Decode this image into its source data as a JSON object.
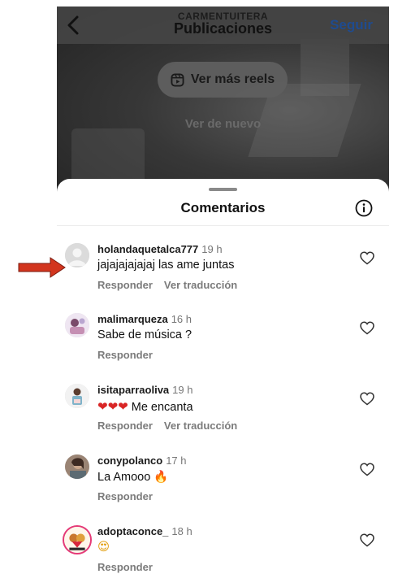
{
  "header": {
    "subtitle": "CARMENTUITERA",
    "title": "Publicaciones",
    "follow_label": "Seguir"
  },
  "video": {
    "reels_button_label": "Ver más reels",
    "replay_label": "Ver de nuevo"
  },
  "comments_sheet": {
    "title": "Comentarios"
  },
  "comments": [
    {
      "username": "holandaquetalca777",
      "time": "19 h",
      "text": "jajajajajajaj las ame juntas",
      "reply_label": "Responder",
      "translate_label": "Ver traducción"
    },
    {
      "username": "malimarqueza",
      "time": "16 h",
      "text": "Sabe de música ?",
      "reply_label": "Responder"
    },
    {
      "username": "isitaparraoliva",
      "time": "19 h",
      "emoji": "❤❤❤",
      "text": "Me encanta",
      "reply_label": "Responder",
      "translate_label": "Ver traducción"
    },
    {
      "username": "conypolanco",
      "time": "17 h",
      "text": "La Amooo",
      "emoji": "🔥",
      "reply_label": "Responder"
    },
    {
      "username": "adoptaconce_",
      "time": "18 h",
      "emoji": "😍",
      "reply_label": "Responder"
    }
  ],
  "colors": {
    "follow_blue": "#1f4b8f",
    "annotation_arrow": "#d2351e",
    "heart_outline": "#333333"
  }
}
